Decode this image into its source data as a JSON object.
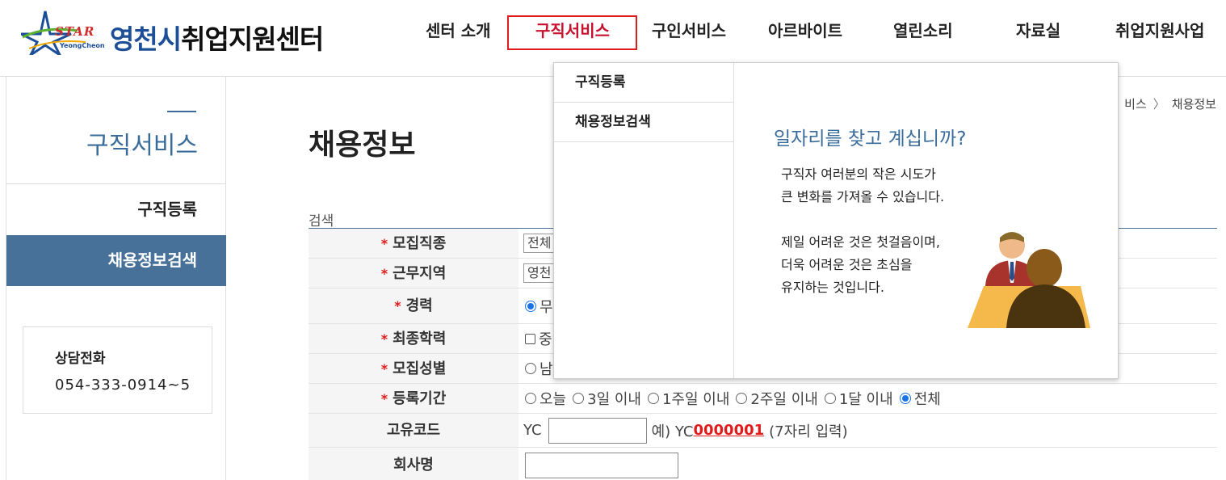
{
  "header": {
    "logo_star": "STAR",
    "logo_sub": "YeongCheon",
    "logo_title_accent": "영천시",
    "logo_title_rest": "취업지원센터",
    "menu": [
      {
        "label": "센터 소개"
      },
      {
        "label": "구직서비스"
      },
      {
        "label": "구인서비스"
      },
      {
        "label": "아르바이트"
      },
      {
        "label": "열린소리"
      },
      {
        "label": "자료실"
      },
      {
        "label": "취업지원사업"
      }
    ]
  },
  "sidebar": {
    "title": "구직서비스",
    "items": [
      {
        "label": "구직등록"
      },
      {
        "label": "채용정보검색"
      }
    ],
    "contact_label": "상담전화",
    "contact_phone": "054-333-0914~5"
  },
  "main": {
    "title": "채용정보",
    "breadcrumb_parent": "비스",
    "breadcrumb_current": "채용정보",
    "search_label": "검색",
    "fields": {
      "job_type": {
        "label": "모집직종",
        "value": "전체"
      },
      "region": {
        "label": "근무지역",
        "value": "영천"
      },
      "career": {
        "label": "경력",
        "value": "무"
      },
      "education": {
        "label": "최종학력",
        "value": "중"
      },
      "gender": {
        "label": "모집성별",
        "value": "남"
      },
      "period": {
        "label": "등록기간",
        "options": [
          "오늘",
          "3일 이내",
          "1주일 이내",
          "2주일 이내",
          "1달 이내",
          "전체"
        ]
      },
      "code": {
        "label": "고유코드",
        "prefix": "YC",
        "example_prefix": "예) YC",
        "example_code": "0000001",
        "example_note": "(7자리 입력)"
      },
      "company": {
        "label": "회사명"
      }
    }
  },
  "dropdown": {
    "items": [
      {
        "label": "구직등록"
      },
      {
        "label": "채용정보검색"
      }
    ],
    "headline": "일자리를 찾고 계십니까?",
    "lines": [
      "구직자 여러분의 작은 시도가",
      "큰 변화를 가져올 수 있습니다.",
      "제일 어려운 것은 첫걸음이며,",
      "더욱 어려운 것은 초심을",
      "유지하는 것입니다."
    ]
  },
  "colors": {
    "accent": "#3a6c9b",
    "active_menu": "#c8102e",
    "highlight_box": "#e01b1b",
    "sidebar_active_bg": "#477199"
  }
}
